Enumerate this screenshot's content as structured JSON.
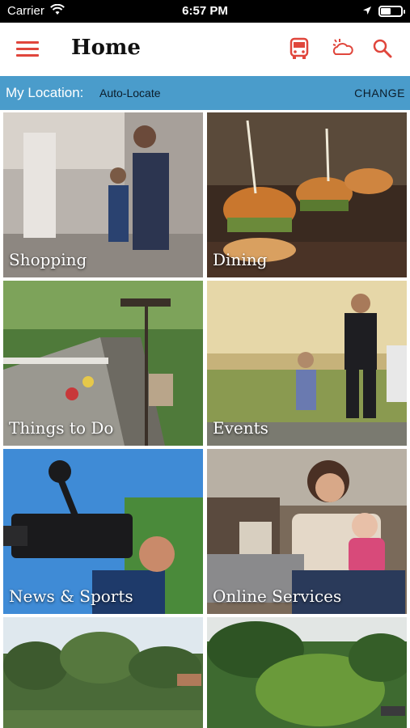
{
  "status_bar": {
    "carrier": "Carrier",
    "time": "6:57 PM"
  },
  "header": {
    "title": "Home",
    "accent_color": "#e0463c",
    "icons": [
      "menu-icon",
      "bus-icon",
      "weather-icon",
      "search-icon"
    ]
  },
  "location": {
    "label": "My Location:",
    "value": "Auto-Locate",
    "change": "CHANGE",
    "bar_color": "#4a9ccb"
  },
  "tiles": [
    {
      "label": "Shopping"
    },
    {
      "label": "Dining"
    },
    {
      "label": "Things to Do"
    },
    {
      "label": "Events"
    },
    {
      "label": "News & Sports"
    },
    {
      "label": "Online Services"
    },
    {
      "label": ""
    },
    {
      "label": ""
    }
  ]
}
